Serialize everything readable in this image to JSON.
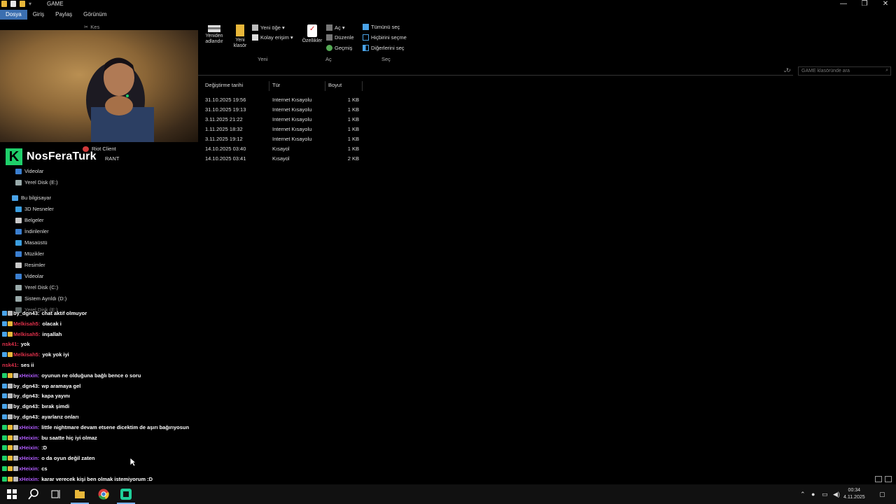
{
  "window": {
    "title": "GAME",
    "controls": [
      "—",
      "❐",
      "✕"
    ]
  },
  "ribbon": {
    "tabs": [
      "Dosya",
      "Giriş",
      "Paylaş",
      "Görünüm"
    ],
    "clipboard_partial": "Kes",
    "rename_label": "Yeniden\nadlandır",
    "new_folder_label": "Yeni\nklasör",
    "new_item_label": "Yeni öğe ▾",
    "easy_access_label": "Kolay erişim ▾",
    "properties_label": "Özellikler",
    "open_label": "Aç ▾",
    "edit_label": "Düzenle",
    "history_label": "Geçmiş",
    "select_all_label": "Tümünü seç",
    "select_none_label": "Hiçbirini seçme",
    "invert_selection_label": "Diğerlerini seç",
    "group_new": "Yeni",
    "group_open": "Aç",
    "group_select": "Seç"
  },
  "search": {
    "placeholder": "GAME klasöründe ara"
  },
  "streamer": {
    "logo": "K",
    "name": "NosFeraTurk"
  },
  "nav": {
    "partial_top": "Riot Client",
    "partial_top2": "RANT",
    "items": [
      {
        "label": "Videolar",
        "icon": "video-folder-icon",
        "color": "#3b7fd0"
      },
      {
        "label": "Yerel Disk (E:)",
        "icon": "drive-icon",
        "color": "#9aa"
      },
      {
        "label": "Bu bilgisayar",
        "icon": "computer-icon",
        "color": "#4aa3e8"
      },
      {
        "label": "3D Nesneler",
        "icon": "3d-objects-icon",
        "color": "#3b9ee0"
      },
      {
        "label": "Belgeler",
        "icon": "documents-icon",
        "color": "#c9c9c9"
      },
      {
        "label": "İndirilenler",
        "icon": "downloads-icon",
        "color": "#3b7fd0"
      },
      {
        "label": "Masaüstü",
        "icon": "desktop-icon",
        "color": "#3b9ee0"
      },
      {
        "label": "Müzikler",
        "icon": "music-icon",
        "color": "#3b7fd0"
      },
      {
        "label": "Resimler",
        "icon": "pictures-icon",
        "color": "#c9c9c9"
      },
      {
        "label": "Videolar",
        "icon": "video-folder-icon",
        "color": "#3b7fd0"
      },
      {
        "label": "Yerel Disk (C:)",
        "icon": "drive-icon",
        "color": "#9aa"
      },
      {
        "label": "Sistem Ayrıldı (D:)",
        "icon": "drive-icon",
        "color": "#9aa"
      },
      {
        "label": "Yerel Disk (E:)",
        "icon": "drive-icon",
        "color": "#9aa"
      }
    ]
  },
  "file_list": {
    "columns": [
      "Değiştirme tarihi",
      "Tür",
      "Boyut"
    ],
    "rows": [
      {
        "date": "31.10.2025 19:56",
        "type": "Internet Kısayolu",
        "size": "1 KB"
      },
      {
        "date": "31.10.2025 19:13",
        "type": "Internet Kısayolu",
        "size": "1 KB"
      },
      {
        "date": "3.11.2025 21:22",
        "type": "Internet Kısayolu",
        "size": "1 KB"
      },
      {
        "date": "1.11.2025 18:32",
        "type": "Internet Kısayolu",
        "size": "1 KB"
      },
      {
        "date": "3.11.2025 19:12",
        "type": "Internet Kısayolu",
        "size": "1 KB"
      },
      {
        "date": "14.10.2025 03:40",
        "type": "Kısayol",
        "size": "1 KB"
      },
      {
        "date": "14.10.2025 03:41",
        "type": "Kısayol",
        "size": "2 KB"
      }
    ]
  },
  "chat": [
    {
      "user": "by_dgn43",
      "user_color": "#ffffff",
      "msg": "chat aktif olmuyor",
      "badges": [
        "#4aa3e8",
        "#bbbbbb"
      ]
    },
    {
      "user": "Melkisah5",
      "user_color": "#e0314b",
      "msg": "olacak i",
      "badges": [
        "#4aa3e8",
        "#e8b73a"
      ]
    },
    {
      "user": "Melkisah5",
      "user_color": "#e0314b",
      "msg": "inşallah",
      "badges": [
        "#4aa3e8",
        "#e8b73a"
      ]
    },
    {
      "user": "nsk41",
      "user_color": "#e0314b",
      "msg": "yok",
      "badges": []
    },
    {
      "user": "Melkisah5",
      "user_color": "#e0314b",
      "msg": "yok yok iyi",
      "badges": [
        "#4aa3e8",
        "#e8b73a"
      ]
    },
    {
      "user": "nsk41",
      "user_color": "#e0314b",
      "msg": "ses ii",
      "badges": []
    },
    {
      "user": "xHeixin",
      "user_color": "#b05bff",
      "msg": "oyunun ne olduğuna bağlı bence o soru",
      "badges": [
        "#1fcf6a",
        "#e8b73a",
        "#bbbbbb"
      ]
    },
    {
      "user": "by_dgn43",
      "user_color": "#ffffff",
      "msg": "wp aramaya gel",
      "badges": [
        "#4aa3e8",
        "#bbbbbb"
      ]
    },
    {
      "user": "by_dgn43",
      "user_color": "#ffffff",
      "msg": "kapa yayını",
      "badges": [
        "#4aa3e8",
        "#bbbbbb"
      ]
    },
    {
      "user": "by_dgn43",
      "user_color": "#ffffff",
      "msg": "bırak şimdi",
      "badges": [
        "#4aa3e8",
        "#bbbbbb"
      ]
    },
    {
      "user": "by_dgn43",
      "user_color": "#ffffff",
      "msg": "ayarlarız onları",
      "badges": [
        "#4aa3e8",
        "#bbbbbb"
      ]
    },
    {
      "user": "xHeixin",
      "user_color": "#b05bff",
      "msg": "little nightmare devam etsene dicektim de aşırı bağırıyosun",
      "badges": [
        "#1fcf6a",
        "#e8b73a",
        "#bbbbbb"
      ]
    },
    {
      "user": "xHeixin",
      "user_color": "#b05bff",
      "msg": "bu saatte hiç iyi olmaz",
      "badges": [
        "#1fcf6a",
        "#e8b73a",
        "#bbbbbb"
      ]
    },
    {
      "user": "xHeixin",
      "user_color": "#b05bff",
      "msg": ":D",
      "badges": [
        "#1fcf6a",
        "#e8b73a",
        "#bbbbbb"
      ]
    },
    {
      "user": "xHeixin",
      "user_color": "#b05bff",
      "msg": "o da oyun değil zaten",
      "badges": [
        "#1fcf6a",
        "#e8b73a",
        "#bbbbbb"
      ]
    },
    {
      "user": "xHeixin",
      "user_color": "#b05bff",
      "msg": "cs",
      "badges": [
        "#1fcf6a",
        "#e8b73a",
        "#bbbbbb"
      ]
    },
    {
      "user": "xHeixin",
      "user_color": "#b05bff",
      "msg": "karar verecek kişi ben olmak istemiyorum :D",
      "badges": [
        "#1fcf6a",
        "#e8b73a",
        "#bbbbbb"
      ]
    }
  ],
  "taskbar": {
    "time": "00:34",
    "date": "4.11.2025",
    "apps": [
      "start-icon",
      "search-icon",
      "task-view-icon",
      "file-explorer-icon",
      "chrome-icon",
      "app-icon"
    ]
  }
}
